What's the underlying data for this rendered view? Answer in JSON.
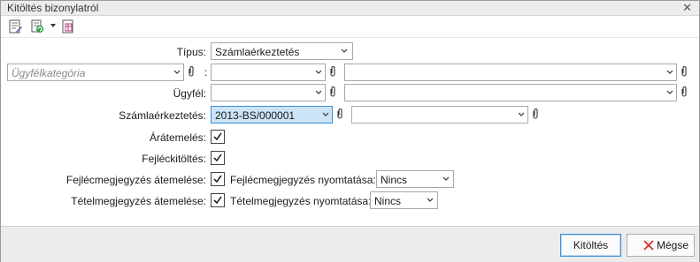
{
  "window": {
    "title": "Kitöltés bizonylatról"
  },
  "toolbar": {
    "icons": [
      "document-edit-icon",
      "document-refresh-icon",
      "dropdown-arrow-icon",
      "document-table-icon"
    ]
  },
  "form": {
    "tipus_label": "Típus:",
    "tipus_value": "Számlaérkeztetés",
    "category_placeholder": "Ügyfélkategória",
    "colon": ":",
    "category_value_1": "",
    "category_value_2": "",
    "ugyfel_label": "Ügyfél:",
    "ugyfel_value_1": "",
    "ugyfel_value_2": "",
    "szamla_label": "Számlaérkeztetés:",
    "szamla_value": "2013-BS/000001",
    "szamla_value_2": "",
    "aratemeles_label": "Árátemelés:",
    "aratemeles_checked": true,
    "fejlec_label": "Fejléckitöltés:",
    "fejlec_checked": true,
    "fejlecmegj_label": "Fejlécmegjegyzés átemelése:",
    "fejlecmegj_checked": true,
    "fejlecmegj_print_label": "Fejlécmegjegyzés nyomtatása:",
    "fejlecmegj_print_value": "Nincs",
    "tetelmegj_label": "Tételmegjegyzés átemelése:",
    "tetelmegj_checked": true,
    "tetelmegj_print_label": "Tételmegjegyzés nyomtatása:",
    "tetelmegj_print_value": "Nincs"
  },
  "buttons": {
    "ok": "Kitöltés",
    "cancel": "Mégse"
  },
  "colors": {
    "selected_bg": "#cce4f7",
    "selected_border": "#3c8fd6",
    "cancel_x": "#d9342b"
  }
}
